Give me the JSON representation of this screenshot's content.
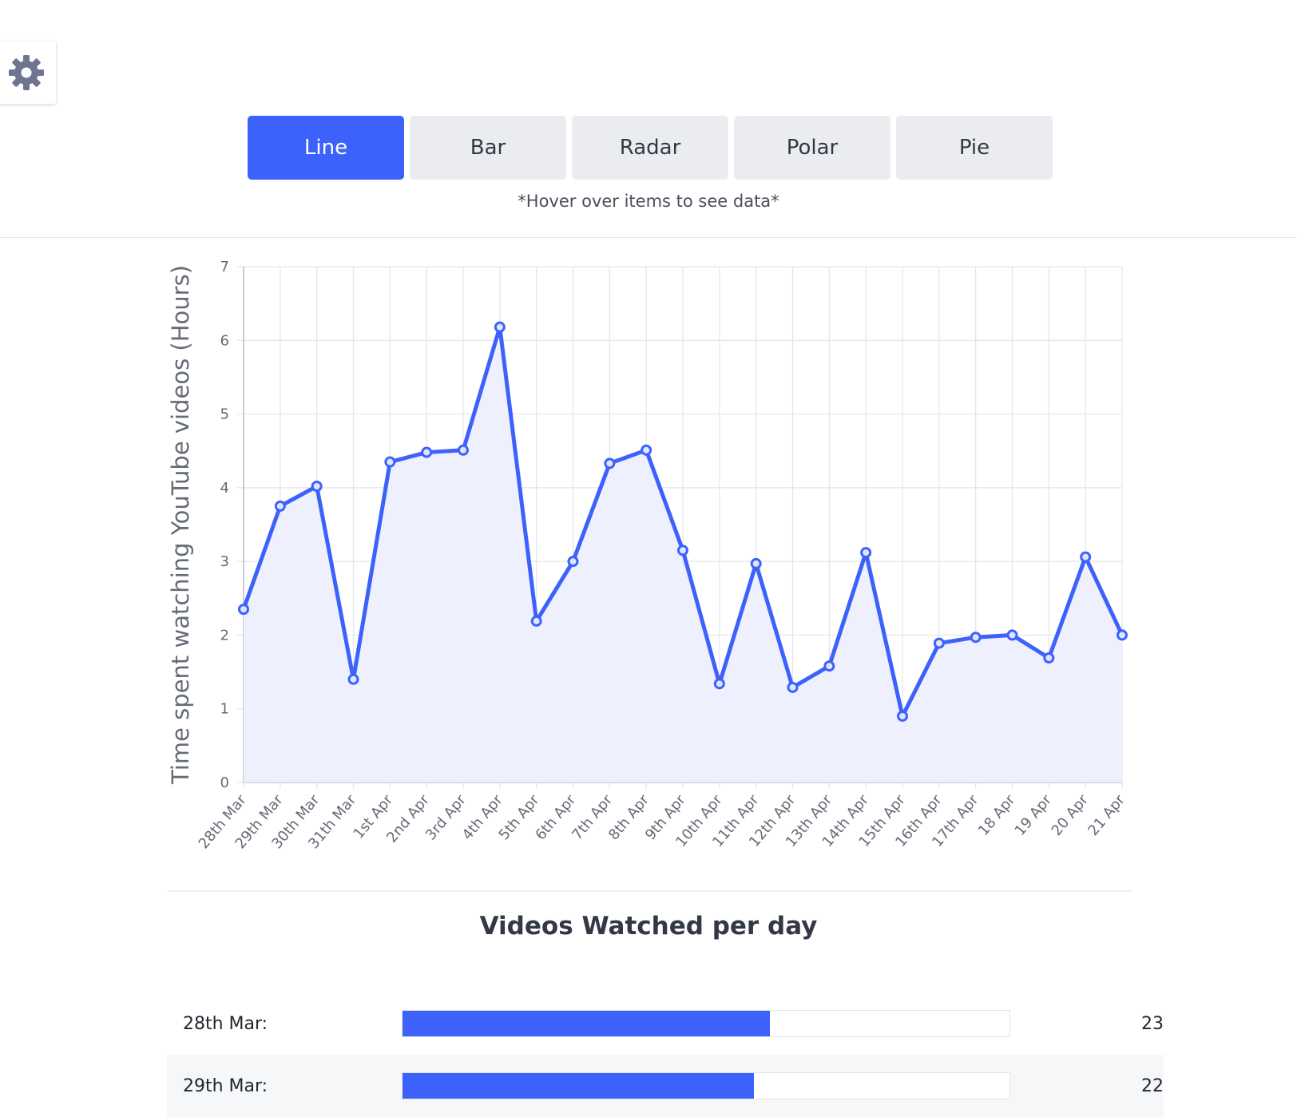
{
  "settings": {
    "icon": "gear-icon",
    "color": "#6d7590"
  },
  "tabs": [
    {
      "label": "Line",
      "active": true
    },
    {
      "label": "Bar",
      "active": false
    },
    {
      "label": "Radar",
      "active": false
    },
    {
      "label": "Polar",
      "active": false
    },
    {
      "label": "Pie",
      "active": false
    }
  ],
  "hint": "*Hover over items to see data*",
  "colors": {
    "accent": "#3d62fb",
    "fill": "#eef0fd",
    "grid": "#e4e5e8",
    "text": "#333845"
  },
  "chart_data": {
    "type": "line",
    "title": "",
    "xlabel": "",
    "ylabel": "Time spent watching YouTube videos (Hours)",
    "ylim": [
      0,
      7
    ],
    "grid": true,
    "area_fill": true,
    "categories": [
      "28th Mar",
      "29th Mar",
      "30th Mar",
      "31th Mar",
      "1st Apr",
      "2nd Apr",
      "3rd Apr",
      "4th Apr",
      "5th Apr",
      "6th Apr",
      "7th Apr",
      "8th Apr",
      "9th Apr",
      "10th Apr",
      "11th Apr",
      "12th Apr",
      "13th Apr",
      "14th Apr",
      "15th Apr",
      "16th Apr",
      "17th Apr",
      "18 Apr",
      "19 Apr",
      "20 Apr",
      "21 Apr"
    ],
    "values": [
      2.35,
      3.75,
      4.02,
      1.4,
      4.35,
      4.48,
      4.51,
      6.18,
      2.19,
      3.0,
      4.33,
      4.51,
      3.15,
      1.34,
      2.97,
      1.29,
      1.58,
      3.12,
      0.9,
      1.89,
      1.97,
      2.0,
      1.69,
      3.06,
      2.0
    ]
  },
  "videos": {
    "title": "Videos Watched per day",
    "max": 38,
    "rows": [
      {
        "label": "28th Mar:",
        "value": 23
      },
      {
        "label": "29th Mar:",
        "value": 22
      }
    ]
  }
}
